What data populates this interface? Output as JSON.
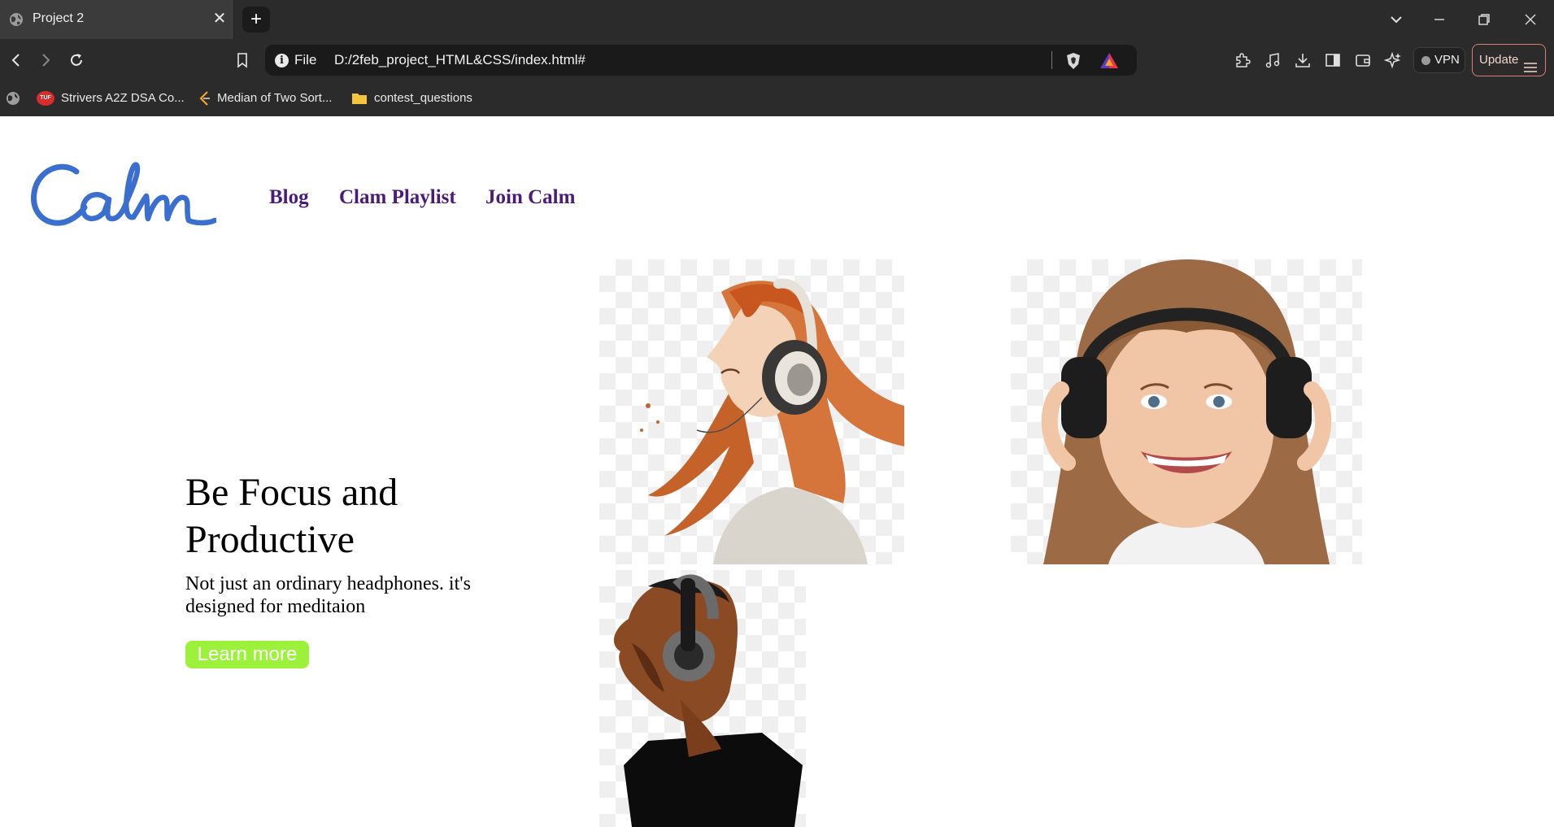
{
  "browser": {
    "tab": {
      "title": "Project 2",
      "close_glyph": "✕",
      "icon": "globe-icon"
    },
    "new_tab_glyph": "+",
    "window_controls": {
      "tab_list": "⌄",
      "minimize": "—",
      "restore": "❐",
      "close": "✕"
    },
    "address": {
      "scheme": "File",
      "url": "D:/2feb_project_HTML&CSS/index.html#"
    },
    "vpn_label": "VPN",
    "update_label": "Update",
    "bookmarks": [
      {
        "label": "Strivers A2Z DSA Co...",
        "icon": "tuf-icon"
      },
      {
        "label": "Median of Two Sort...",
        "icon": "leetcode-icon"
      },
      {
        "label": "contest_questions",
        "icon": "folder-icon"
      }
    ]
  },
  "page": {
    "logo_text": "Calm",
    "nav": [
      "Blog",
      "Clam Playlist",
      "Join Calm"
    ],
    "hero": {
      "title": "Be Focus and Productive",
      "subtitle": "Not just an ordinary headphones. it's designed for meditaion",
      "cta": "Learn more"
    },
    "colors": {
      "nav_link": "#4b1b7a",
      "logo": "#3b6fcf",
      "cta_background": "#9cf23a",
      "chrome_background": "#2b2b2b"
    }
  }
}
